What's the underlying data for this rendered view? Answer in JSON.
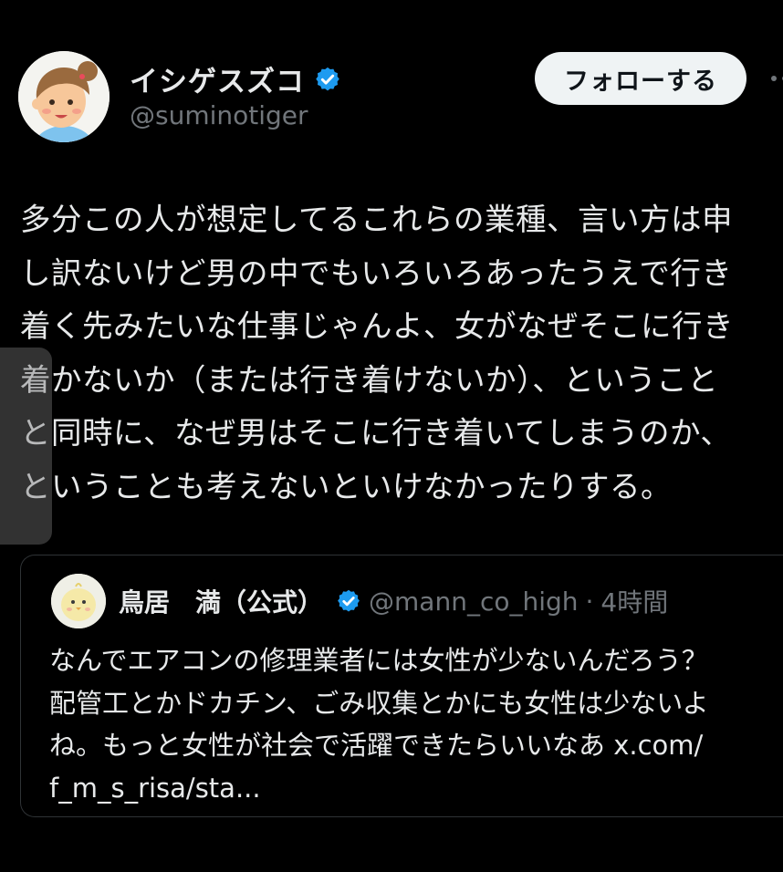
{
  "author": {
    "display_name": "イシゲスズコ",
    "handle": "@suminotiger",
    "verified": true,
    "avatar": "cartoon-girl-avatar"
  },
  "follow_button": {
    "label": "フォローする"
  },
  "more_icon": "more-dots-icon",
  "tweet": {
    "text": "多分この人が想定してるこれらの業種、言い方は申\nし訳ないけど男の中でもいろいろあったうえで行き\n着く先みたいな仕事じゃんよ、女がなぜそこに行き\n着かないか（または行き着けないか）、ということ\nと同時に、なぜ男はそこに行き着いてしまうのか、\nということも考えないといけなかったりする。"
  },
  "quoted_tweet": {
    "display_name": "鳥居　満（公式）",
    "handle": "@mann_co_high",
    "separator": "·",
    "time": "4時間",
    "verified": true,
    "avatar": "chick-avatar",
    "text": "なんでエアコンの修理業者には女性が少ないんだろう？\n配管工とかドカチン、ごみ収集とかにも女性は少ないよ\nね。もっと女性が社会で活躍できたらいいなあ x.com/\nf_m_s_risa/sta..."
  },
  "colors": {
    "background": "#000000",
    "text": "#e7e9ea",
    "muted": "#71767b",
    "verified": "#1d9bf0",
    "border": "#2f3336",
    "button_bg": "#eff3f4"
  }
}
